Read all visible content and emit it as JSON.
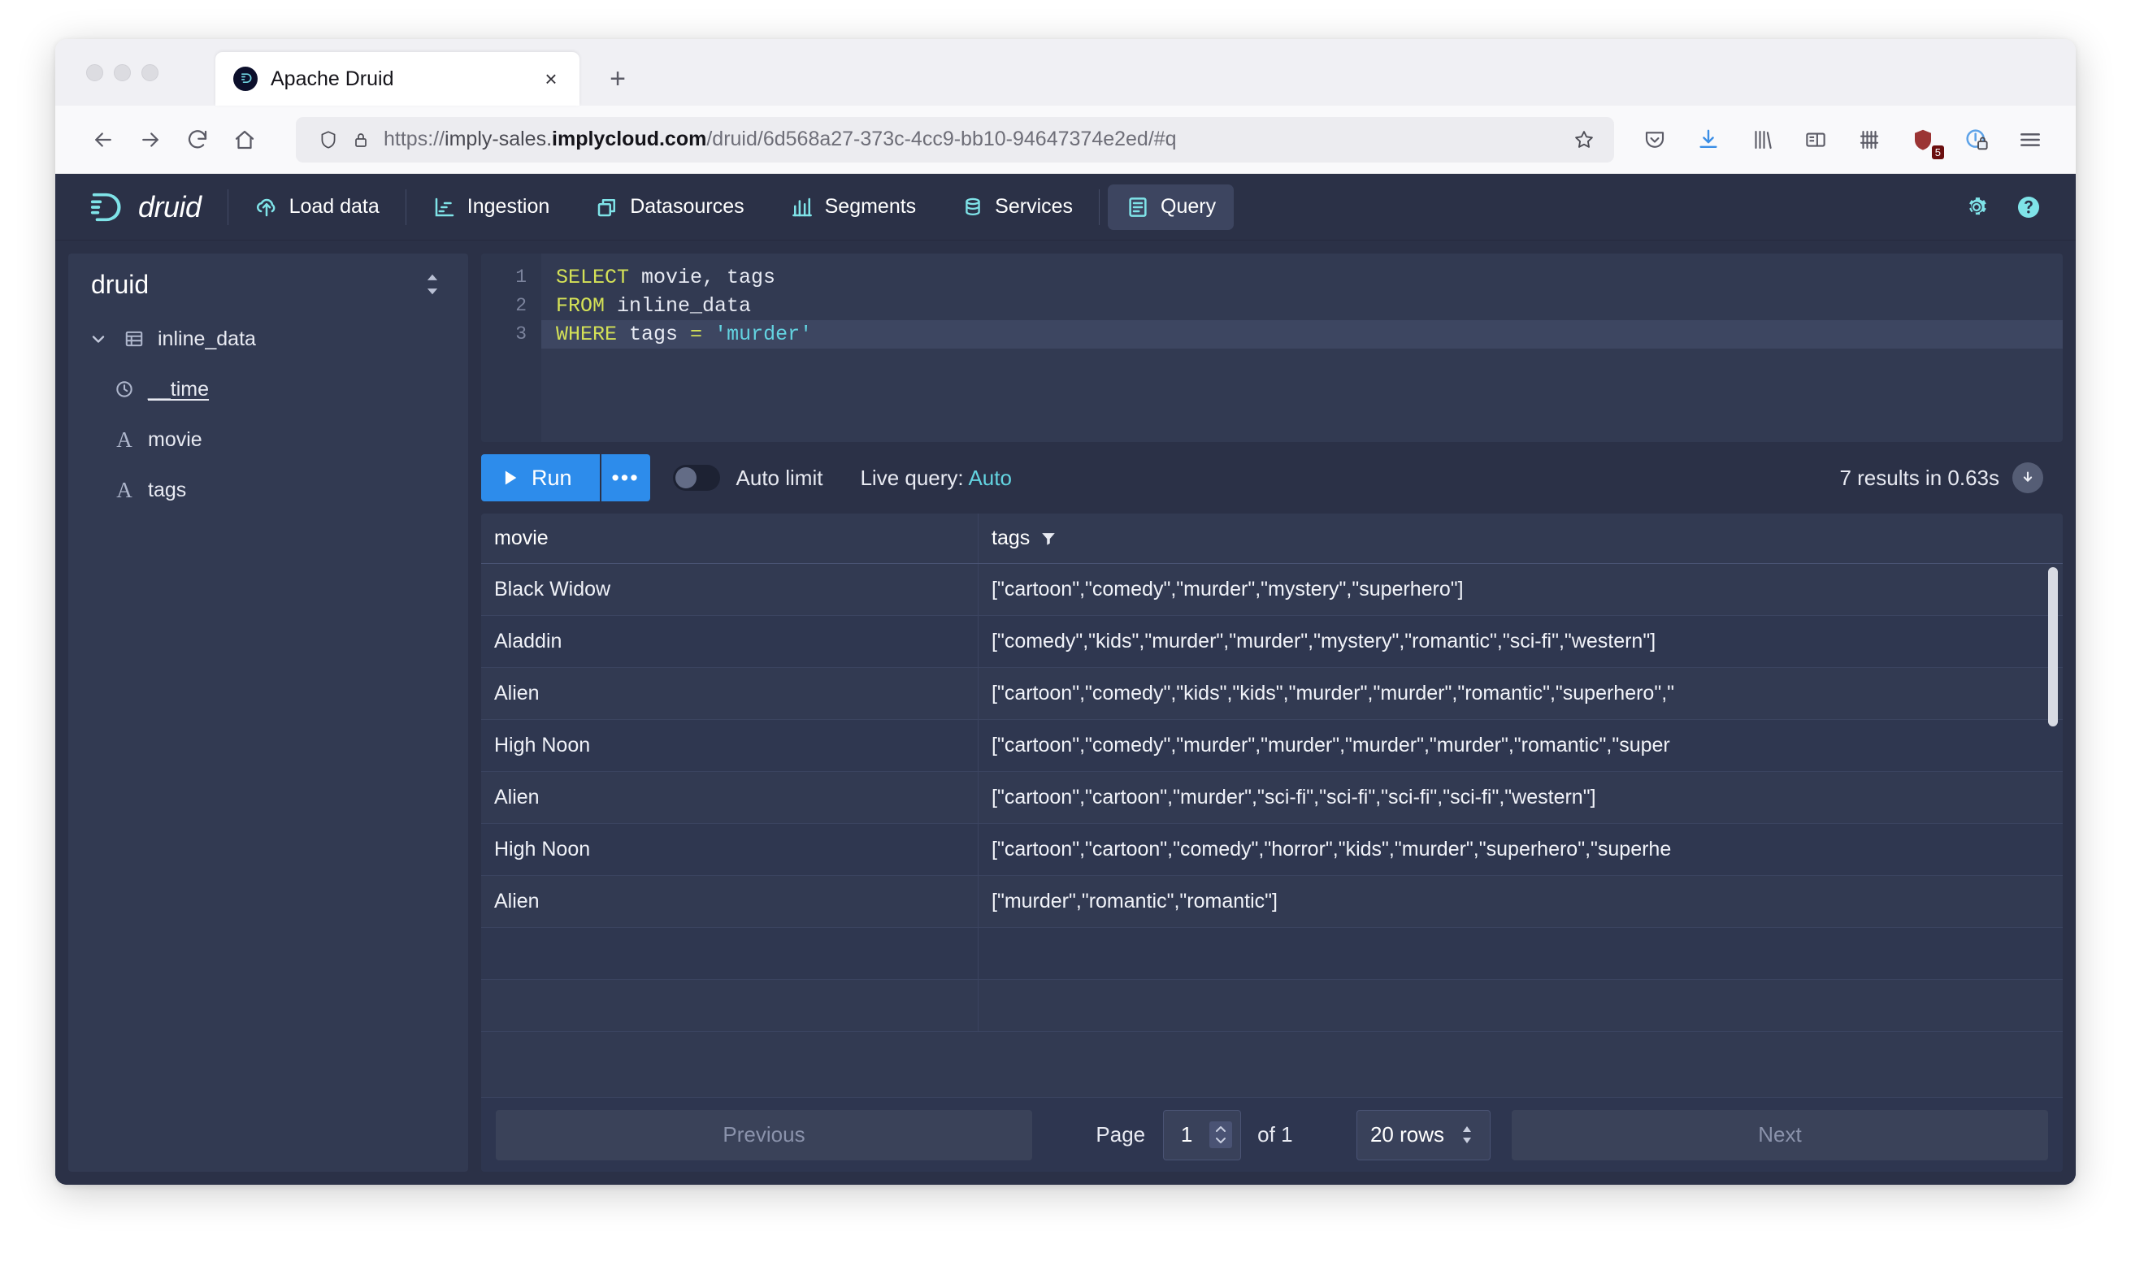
{
  "browser": {
    "tab": {
      "title": "Apache Druid",
      "favicon": "druid-favicon",
      "close_label": "×"
    },
    "new_tab_label": "+",
    "url": {
      "scheme": "https://",
      "subdomain": "imply-sales.",
      "host": "implycloud.com",
      "path": "/druid/6d568a27-373c-4cc9-bb10-94647374e2ed/#q"
    },
    "toolbar_icons": [
      "pocket-icon",
      "download-icon",
      "library-icon",
      "sidebar-icon",
      "shelf-icon",
      "ublock-shield-icon",
      "container-lock-icon",
      "hamburger-menu-icon"
    ],
    "ublock_badge": "5"
  },
  "druid": {
    "brand": "druid",
    "nav": [
      {
        "label": "Load data",
        "icon": "upload-cloud-icon",
        "active": false
      },
      {
        "label": "Ingestion",
        "icon": "ingestion-icon",
        "active": false
      },
      {
        "label": "Datasources",
        "icon": "datasources-icon",
        "active": false
      },
      {
        "label": "Segments",
        "icon": "segments-icon",
        "active": false
      },
      {
        "label": "Services",
        "icon": "services-icon",
        "active": false
      },
      {
        "label": "Query",
        "icon": "query-icon",
        "active": true
      }
    ],
    "header_actions": [
      "gear-icon",
      "help-icon"
    ],
    "accent_color": "#7fe3e8",
    "primary_button_color": "#2d8ceb"
  },
  "sidebar": {
    "title": "druid",
    "tree": [
      {
        "label": "inline_data",
        "icon": "table-icon",
        "level": 0,
        "expanded": true,
        "underline": false
      },
      {
        "label": "__time",
        "icon": "clock-icon",
        "level": 1,
        "expanded": false,
        "underline": true
      },
      {
        "label": "movie",
        "icon": "type-a-icon",
        "level": 1,
        "expanded": false,
        "underline": false
      },
      {
        "label": "tags",
        "icon": "type-a-icon",
        "level": 1,
        "expanded": false,
        "underline": false
      }
    ]
  },
  "editor": {
    "lines": [
      {
        "number": "1",
        "tokens": [
          {
            "t": "kw",
            "v": "SELECT"
          },
          {
            "t": "plain",
            "v": " movie, tags"
          }
        ],
        "current": false
      },
      {
        "number": "2",
        "tokens": [
          {
            "t": "kw",
            "v": "FROM"
          },
          {
            "t": "plain",
            "v": " inline_data"
          }
        ],
        "current": false
      },
      {
        "number": "3",
        "tokens": [
          {
            "t": "kw",
            "v": "WHERE"
          },
          {
            "t": "plain",
            "v": " tags "
          },
          {
            "t": "kw",
            "v": "="
          },
          {
            "t": "plain",
            "v": " "
          },
          {
            "t": "str",
            "v": "'murder'"
          }
        ],
        "current": true
      }
    ]
  },
  "run_bar": {
    "run_label": "Run",
    "more_label": "•••",
    "auto_limit_label": "Auto limit",
    "auto_limit_on": false,
    "live_query_prefix": "Live query: ",
    "live_query_value": "Auto",
    "results_meta": "7 results in 0.63s",
    "download_icon": "download-circle-icon"
  },
  "results": {
    "columns": [
      {
        "name": "movie",
        "filterable": false
      },
      {
        "name": "tags",
        "filterable": true,
        "filter_icon": "funnel-icon"
      }
    ],
    "rows": [
      {
        "movie": "Black Widow",
        "tags": "[\"cartoon\",\"comedy\",\"murder\",\"mystery\",\"superhero\"]"
      },
      {
        "movie": "Aladdin",
        "tags": "[\"comedy\",\"kids\",\"murder\",\"murder\",\"mystery\",\"romantic\",\"sci-fi\",\"western\"]"
      },
      {
        "movie": "Alien",
        "tags": "[\"cartoon\",\"comedy\",\"kids\",\"kids\",\"murder\",\"murder\",\"romantic\",\"superhero\",\""
      },
      {
        "movie": "High Noon",
        "tags": "[\"cartoon\",\"comedy\",\"murder\",\"murder\",\"murder\",\"murder\",\"romantic\",\"super"
      },
      {
        "movie": "Alien",
        "tags": "[\"cartoon\",\"cartoon\",\"murder\",\"sci-fi\",\"sci-fi\",\"sci-fi\",\"sci-fi\",\"western\"]"
      },
      {
        "movie": "High Noon",
        "tags": "[\"cartoon\",\"cartoon\",\"comedy\",\"horror\",\"kids\",\"murder\",\"superhero\",\"superhe"
      },
      {
        "movie": "Alien",
        "tags": "[\"murder\",\"romantic\",\"romantic\"]"
      },
      {
        "movie": "",
        "tags": ""
      },
      {
        "movie": "",
        "tags": ""
      }
    ]
  },
  "pagination": {
    "previous_label": "Previous",
    "next_label": "Next",
    "page_label": "Page",
    "page_value": "1",
    "of_label": "of 1",
    "rows_per_page": "20 rows"
  }
}
